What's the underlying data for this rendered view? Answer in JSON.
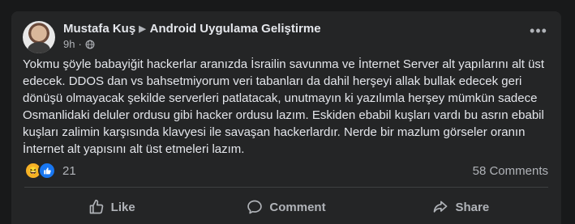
{
  "post": {
    "author": "Mustafa Kuş",
    "group": "Android Uygulama Geliştirme",
    "time": "9h",
    "separator": "·",
    "text": [
      "Yokmu şöyle babayiğit hackerlar aranızda İsrailin savunma ve İnternet Server alt yapılarını alt üst edecek. DDOS dan vs bahsetmiyorum veri tabanları da dahil herşeyi allak bullak edecek geri dönüşü olmayacak şekilde serverleri patlatacak, unutmayın ki yazılımla herşey mümkün sadece Osmanlidaki deluler ordusu gibi hacker ordusu lazım. Eskiden ebabil kuşları vardı bu asrın ebabil kuşları zalimin karşısında klavyesi ile savaşan hackerlardır. Nerde bir mazlum görseler oranın İnternet alt yapısını alt üst etmeleri lazım."
    ],
    "reaction_count": "21",
    "comments_label": "58 Comments"
  },
  "actions": {
    "like": "Like",
    "comment": "Comment",
    "share": "Share"
  },
  "icons": {
    "more": "more-icon",
    "globe": "globe-icon",
    "haha": "haha-reaction-icon",
    "like_reaction": "like-reaction-icon"
  },
  "colors": {
    "background": "#18191a",
    "card": "#242526",
    "text": "#e4e6eb",
    "secondary": "#b0b3b8",
    "like_blue": "#1877f2",
    "haha_yellow": "#f7b125"
  }
}
